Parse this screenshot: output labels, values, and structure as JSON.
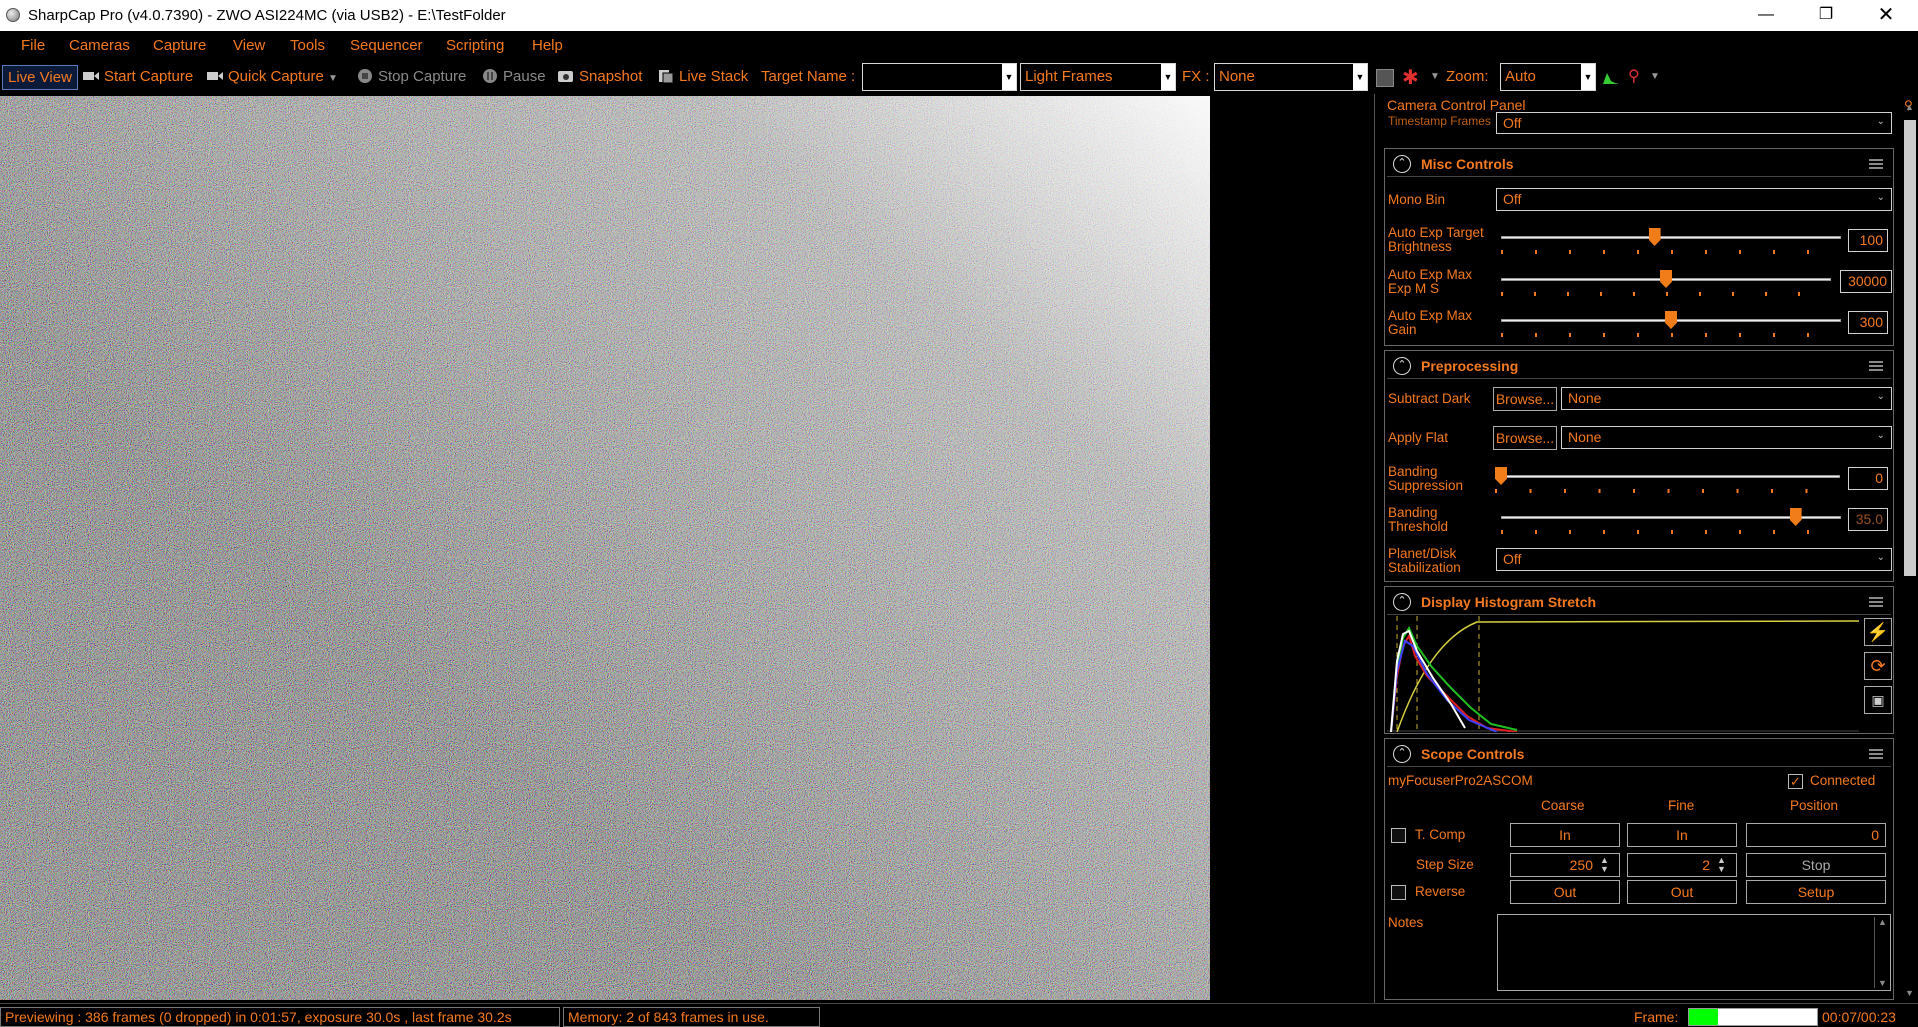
{
  "window": {
    "title": "SharpCap Pro (v4.0.7390) - ZWO ASI224MC (via USB2) - E:\\TestFolder"
  },
  "menu": [
    "File",
    "Cameras",
    "Capture",
    "View",
    "Tools",
    "Sequencer",
    "Scripting",
    "Help"
  ],
  "toolbar": {
    "live_view": "Live View",
    "start_capture": "Start Capture",
    "quick_capture": "Quick Capture",
    "stop_capture": "Stop Capture",
    "pause": "Pause",
    "snapshot": "Snapshot",
    "live_stack": "Live Stack",
    "target_name_label": "Target Name :",
    "target_name_value": "",
    "frame_type": "Light Frames",
    "fx_label": "FX :",
    "fx_value": "None",
    "zoom_label": "Zoom:",
    "zoom_value": "Auto"
  },
  "panel": {
    "title": "Camera Control Panel",
    "timestamp_label": "Timestamp Frames",
    "timestamp_value": "Off",
    "misc": {
      "title": "Misc Controls",
      "mono_bin_label": "Mono Bin",
      "mono_bin_value": "Off",
      "auto_exp_target_label": "Auto Exp Target Brightness",
      "auto_exp_target_value": "100",
      "auto_exp_max_ms_label": "Auto Exp Max Exp M S",
      "auto_exp_max_ms_value": "30000",
      "auto_exp_max_gain_label": "Auto Exp Max Gain",
      "auto_exp_max_gain_value": "300"
    },
    "preprocessing": {
      "title": "Preprocessing",
      "subtract_dark_label": "Subtract Dark",
      "apply_flat_label": "Apply Flat",
      "browse": "Browse...",
      "dark_value": "None",
      "flat_value": "None",
      "banding_suppression_label": "Banding Suppression",
      "banding_suppression_value": "0",
      "banding_threshold_label": "Banding Threshold",
      "banding_threshold_value": "35.0",
      "planet_label": "Planet/Disk Stabilization",
      "planet_value": "Off"
    },
    "histogram": {
      "title": "Display Histogram Stretch"
    },
    "scope": {
      "title": "Scope Controls",
      "device": "myFocuserPro2ASCOM",
      "connected_label": "Connected",
      "connected": true,
      "coarse": "Coarse",
      "fine": "Fine",
      "position": "Position",
      "tcomp": "T. Comp",
      "in": "In",
      "out": "Out",
      "position_value": "0",
      "step_size": "Step Size",
      "coarse_step": "250",
      "fine_step": "2",
      "stop": "Stop",
      "reverse": "Reverse",
      "setup": "Setup"
    },
    "notes_label": "Notes"
  },
  "status": {
    "previewing": "Previewing : 386 frames (0 dropped) in 0:01:57, exposure 30.0s , last frame 30.2s",
    "memory": "Memory: 2 of 843 frames in use.",
    "frame_label": "Frame:",
    "frame_progress": 0.23,
    "frame_time": "00:07/00:23"
  },
  "slider_levels": {
    "auto_exp_target": 0.45,
    "auto_exp_max_ms": 0.5,
    "auto_exp_max_gain": 0.5,
    "banding_suppression": 0.0,
    "banding_threshold": 0.88
  },
  "colors": {
    "accent": "#f57a1f",
    "background": "#000000"
  }
}
